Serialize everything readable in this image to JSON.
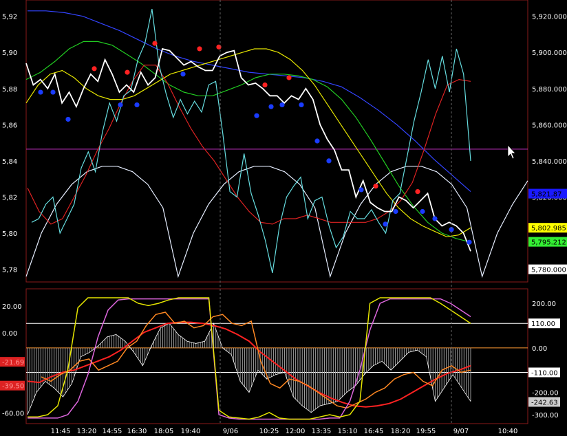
{
  "chart_data": [
    {
      "type": "line",
      "panel": "price",
      "title": "",
      "xlabel": "",
      "ylabel": "",
      "left_axis_ticks": [
        "5,92",
        "5,90",
        "5,88",
        "5,86",
        "5,84",
        "5,82",
        "5,80",
        "5,78"
      ],
      "left_axis_values": [
        5.92,
        5.9,
        5.88,
        5.86,
        5.84,
        5.82,
        5.8,
        5.78
      ],
      "right_axis_ticks": [
        "5,920.000",
        "5,900.000",
        "5,880.000",
        "5,860.000",
        "5,840.000",
        "5,820.000",
        "5,780.000"
      ],
      "right_axis_values": [
        5920,
        5900,
        5880,
        5860,
        5840,
        5820,
        5780
      ],
      "ylim": [
        5773,
        5929
      ],
      "price_labels": [
        {
          "text": "5,802.985",
          "value": 5802.985,
          "bg": "#ffff00",
          "fg": "#000000"
        },
        {
          "text": "5,795.212",
          "value": 5795.212,
          "bg": "#33ee33",
          "fg": "#000000"
        },
        {
          "text": "5,780.000",
          "value": 5780.0,
          "bg": "#ffffff",
          "fg": "#000000"
        },
        {
          "text": "5,821.87",
          "value": 5821.87,
          "bg": "#1a1aff",
          "fg": "#000000"
        }
      ],
      "horizontal_line": {
        "value": 5846.5,
        "color": "#cc33cc"
      },
      "series": [
        {
          "color": "#ffffff",
          "values": [
            5.894,
            5.882,
            5.885,
            5.88,
            5.888,
            5.872,
            5.878,
            5.87,
            5.88,
            5.888,
            5.884,
            5.896,
            5.888,
            5.878,
            5.882,
            5.878,
            5.889,
            5.882,
            5.886,
            5.902,
            5.901,
            5.897,
            5.893,
            5.895,
            5.892,
            5.89,
            5.89,
            5.898,
            5.9,
            5.901,
            5.886,
            5.882,
            5.883,
            5.88,
            5.876,
            5.876,
            5.872,
            5.876,
            5.874,
            5.88,
            5.874,
            5.86,
            5.852,
            5.846,
            5.835,
            5.835,
            5.82,
            5.829,
            5.817,
            5.814,
            5.812,
            5.812,
            5.82,
            5.818,
            5.814,
            5.818,
            5.822,
            5.808,
            5.804,
            5.806,
            5.804,
            5.8,
            5.79
          ]
        },
        {
          "color": "#66dde0",
          "values": [
            5.806,
            5.808,
            5.816,
            5.82,
            5.8,
            5.808,
            5.816,
            5.836,
            5.845,
            5.834,
            5.856,
            5.872,
            5.862,
            5.876,
            5.879,
            5.896,
            5.905,
            5.924,
            5.893,
            5.877,
            5.864,
            5.874,
            5.866,
            5.873,
            5.867,
            5.882,
            5.884,
            5.855,
            5.823,
            5.82,
            5.844,
            5.822,
            5.81,
            5.796,
            5.778,
            5.804,
            5.82,
            5.826,
            5.831,
            5.808,
            5.818,
            5.82,
            5.804,
            5.792,
            5.798,
            5.812,
            5.808,
            5.808,
            5.813,
            5.806,
            5.8,
            5.818,
            5.822,
            5.842,
            5.862,
            5.878,
            5.896,
            5.88,
            5.898,
            5.878,
            5.902,
            5.888,
            5.84
          ]
        },
        {
          "color": "#dd2222",
          "values": [
            5.825,
            5.812,
            5.805,
            5.808,
            5.82,
            5.832,
            5.846,
            5.858,
            5.872,
            5.884,
            5.893,
            5.893,
            5.883,
            5.87,
            5.858,
            5.848,
            5.84,
            5.83,
            5.82,
            5.812,
            5.806,
            5.805,
            5.808,
            5.808,
            5.81,
            5.808,
            5.806,
            5.806,
            5.806,
            5.806,
            5.808,
            5.812,
            5.818,
            5.828,
            5.846,
            5.866,
            5.882,
            5.885,
            5.884
          ]
        },
        {
          "color": "#e6e600",
          "values": [
            5.872,
            5.882,
            5.888,
            5.89,
            5.886,
            5.88,
            5.876,
            5.874,
            5.874,
            5.876,
            5.88,
            5.884,
            5.888,
            5.89,
            5.892,
            5.894,
            5.896,
            5.898,
            5.9,
            5.902,
            5.902,
            5.9,
            5.896,
            5.89,
            5.882,
            5.872,
            5.862,
            5.852,
            5.842,
            5.832,
            5.822,
            5.814,
            5.808,
            5.804,
            5.801,
            5.798,
            5.799,
            5.803
          ]
        },
        {
          "color": "#22cc22",
          "values": [
            5.885,
            5.889,
            5.895,
            5.902,
            5.906,
            5.906,
            5.904,
            5.899,
            5.894,
            5.888,
            5.882,
            5.878,
            5.876,
            5.876,
            5.879,
            5.882,
            5.886,
            5.888,
            5.888,
            5.887,
            5.885,
            5.881,
            5.874,
            5.864,
            5.852,
            5.839,
            5.826,
            5.815,
            5.806,
            5.8,
            5.797,
            5.795
          ]
        },
        {
          "color": "#3344ff",
          "values": [
            5.923,
            5.923,
            5.922,
            5.92,
            5.916,
            5.912,
            5.907,
            5.902,
            5.898,
            5.895,
            5.893,
            5.891,
            5.889,
            5.888,
            5.887,
            5.886,
            5.884,
            5.881,
            5.875,
            5.868,
            5.86,
            5.851,
            5.841,
            5.832,
            5.823
          ]
        },
        {
          "color": "#e6eeff",
          "values": [
            5.776,
            5.8,
            5.816,
            5.827,
            5.834,
            5.837,
            5.837,
            5.834,
            5.827,
            5.814,
            5.776,
            5.8,
            5.816,
            5.827,
            5.834,
            5.837,
            5.837,
            5.834,
            5.827,
            5.814,
            5.776,
            5.8,
            5.816,
            5.827,
            5.834,
            5.837,
            5.837,
            5.834,
            5.827,
            5.814,
            5.776,
            5.8,
            5.816,
            5.829
          ]
        }
      ],
      "markers": [
        {
          "color": "#ff2222",
          "values": [
            5.891,
            5.889,
            5.905,
            5.902,
            5.903,
            5.882,
            5.886,
            5.826,
            5.823
          ]
        },
        {
          "color": "#1a3cff",
          "values": [
            5.878,
            5.878,
            5.863,
            5.871,
            5.871,
            5.888,
            5.865,
            5.87,
            5.871,
            5.871,
            5.851,
            5.84,
            5.824,
            5.805,
            5.812,
            5.812,
            5.808,
            5.802,
            5.795
          ]
        }
      ]
    },
    {
      "type": "line",
      "panel": "oscillator",
      "title": "",
      "xlabel": "",
      "ylabel": "",
      "left_axis_ticks": [
        "20.00",
        "0.00",
        "-60.00"
      ],
      "left_axis_values": [
        20,
        0,
        -60
      ],
      "right_axis_ticks": [
        "200.00",
        "0.00",
        "-200.00",
        "-300.00"
      ],
      "right_axis_values": [
        200,
        0,
        -200,
        -300
      ],
      "left_ylim": [
        -68,
        33
      ],
      "right_ylim": [
        -340,
        265
      ],
      "value_labels": [
        {
          "text": "-21.69",
          "value": -21.69,
          "side": "left",
          "bg": "#dd2222",
          "fg": "#ff9999"
        },
        {
          "text": "-39.50",
          "value": -39.5,
          "side": "left",
          "bg": "#dd2222",
          "fg": "#ff9999"
        },
        {
          "text": "110.00",
          "value": 110,
          "side": "right",
          "bg": "#ffffff",
          "fg": "#000000"
        },
        {
          "text": "-110.00",
          "value": -110,
          "side": "right",
          "bg": "#ffffff",
          "fg": "#000000"
        },
        {
          "text": "-242.63",
          "value": -242.63,
          "side": "right",
          "bg": "#cccccc",
          "fg": "#000000"
        }
      ],
      "level_lines": [
        {
          "value": 110,
          "color": "#ffffff"
        },
        {
          "value": -110,
          "color": "#ffffff"
        },
        {
          "value": 0,
          "color": "#ff9933"
        }
      ],
      "series": [
        {
          "color": "#e6e600",
          "values": [
            -310,
            -310,
            -300,
            -260,
            -100,
            180,
            225,
            225,
            225,
            225,
            225,
            200,
            190,
            200,
            215,
            225,
            225,
            225,
            225,
            -280,
            -310,
            -315,
            -320,
            -310,
            -290,
            -315,
            -320,
            -320,
            -320,
            -310,
            -300,
            -310,
            -300,
            -240,
            200,
            225,
            225,
            225,
            225,
            225,
            225,
            200,
            170,
            140,
            110
          ]
        },
        {
          "color": "#dd66dd",
          "values": [
            -315,
            -315,
            -315,
            -315,
            -300,
            -240,
            -120,
            50,
            170,
            215,
            220,
            220,
            220,
            220,
            220,
            220,
            220,
            220,
            220,
            -300,
            -315,
            -320,
            -320,
            -320,
            -320,
            -320,
            -320,
            -320,
            -320,
            -320,
            -315,
            -315,
            -240,
            -100,
            80,
            200,
            220,
            220,
            220,
            220,
            220,
            220,
            200,
            170,
            140
          ]
        },
        {
          "color": "#ff8822",
          "values": [
            -130,
            -150,
            -120,
            -100,
            -60,
            -50,
            -100,
            -80,
            -60,
            0,
            30,
            100,
            150,
            160,
            110,
            120,
            90,
            100,
            140,
            150,
            110,
            100,
            120,
            -60,
            -160,
            -180,
            -140,
            -150,
            -170,
            -200,
            -230,
            -260,
            -270,
            -250,
            -230,
            -200,
            -180,
            -140,
            -120,
            -110,
            -150,
            -170,
            -100,
            -80,
            -110,
            -100
          ]
        },
        {
          "color": "#ff2222",
          "values": [
            -150,
            -155,
            -130,
            -110,
            -100,
            -80,
            -60,
            -40,
            -10,
            30,
            70,
            90,
            110,
            115,
            115,
            110,
            100,
            85,
            60,
            30,
            -20,
            -60,
            -100,
            -140,
            -170,
            -200,
            -225,
            -245,
            -260,
            -265,
            -260,
            -250,
            -230,
            -200,
            -170,
            -140,
            -115,
            -100,
            -80
          ]
        },
        {
          "color": "#cccccc",
          "values": [
            -300,
            -200,
            -150,
            -180,
            -220,
            -160,
            -40,
            -20,
            10,
            50,
            60,
            30,
            -20,
            -80,
            10,
            90,
            110,
            60,
            30,
            20,
            30,
            110,
            0,
            -30,
            -150,
            -200,
            -100,
            -140,
            -120,
            -110,
            -220,
            -260,
            -290,
            -260,
            -250,
            -240,
            -200,
            -170,
            -120,
            -80,
            -60,
            -100,
            -60,
            -20,
            -10,
            -40,
            -240,
            -180,
            -120,
            -180,
            -240
          ]
        }
      ]
    }
  ],
  "x_axis_labels": [
    "11:45",
    "13:20",
    "14:55",
    "16:30",
    "18:05",
    "19:40",
    "9/06",
    "10:25",
    "12:00",
    "13:35",
    "15:10",
    "16:45",
    "18:20",
    "19:55",
    "9/07",
    "10:40"
  ],
  "x_separators": [
    "9/06",
    "9/07"
  ]
}
